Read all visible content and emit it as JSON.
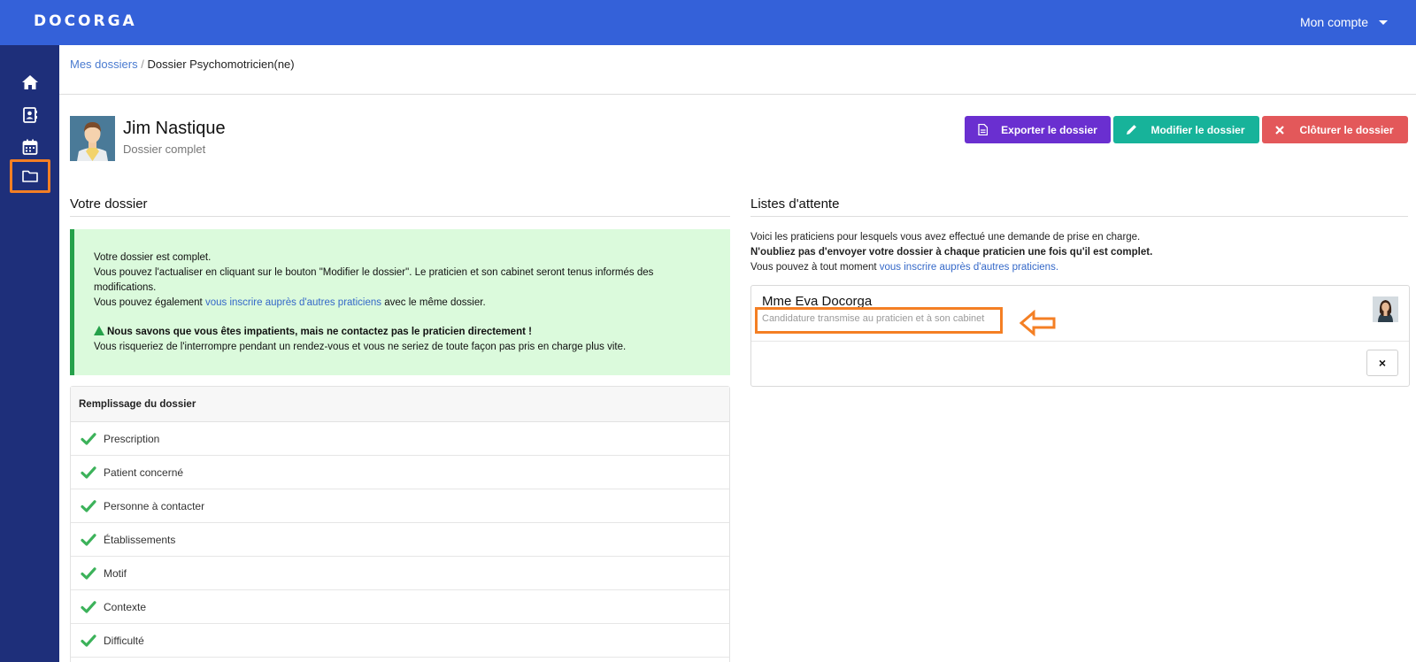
{
  "app": {
    "logo": "DOCORGA",
    "account_label": "Mon compte"
  },
  "sidebar": {
    "items": [
      {
        "icon": "home-icon",
        "active": false
      },
      {
        "icon": "contact-book-icon",
        "active": false
      },
      {
        "icon": "calendar-icon",
        "active": false
      },
      {
        "icon": "folder-icon",
        "active": true
      }
    ]
  },
  "breadcrumb": {
    "parent": "Mes dossiers",
    "separator": "/",
    "current": "Dossier Psychomotricien(ne)"
  },
  "patient": {
    "name": "Jim Nastique",
    "status": "Dossier complet"
  },
  "actions": {
    "export_label": "Exporter le dossier",
    "edit_label": "Modifier le dossier",
    "close_label": "Clôturer le dossier",
    "export_color": "#6a2fd0",
    "edit_color": "#17b39a",
    "close_color": "#e3585a"
  },
  "dossier": {
    "title": "Votre dossier",
    "alert": {
      "line1": "Votre dossier est complet.",
      "line2": "Vous pouvez l'actualiser en cliquant sur le bouton \"Modifier le dossier\". Le praticien et son cabinet seront tenus informés des modifications.",
      "line3_before": "Vous pouvez également ",
      "line3_link": "vous inscrire auprès d'autres praticiens",
      "line3_after": " avec le même dossier.",
      "warning_bold": "Nous savons que vous êtes impatients, mais ne contactez pas le praticien directement !",
      "warning_text": "Vous risqueriez de l'interrompre pendant un rendez-vous et vous ne seriez de toute façon pas pris en charge plus vite."
    },
    "checklist_header": "Remplissage du dossier",
    "checklist": [
      "Prescription",
      "Patient concerné",
      "Personne à contacter",
      "Établissements",
      "Motif",
      "Contexte",
      "Difficulté"
    ]
  },
  "waitlist": {
    "title": "Listes d'attente",
    "intro": "Voici les praticiens pour lesquels vous avez effectué une demande de prise en charge.",
    "reminder": "N'oubliez pas d'envoyer votre dossier à chaque praticien une fois qu'il est complet.",
    "more_before": "Vous pouvez à tout moment ",
    "more_link": "vous inscrire auprès d'autres praticiens.",
    "entries": [
      {
        "name": "Mme Eva Docorga",
        "status": "Candidature transmise au praticien et à son cabinet",
        "remove_label": "×"
      }
    ]
  }
}
